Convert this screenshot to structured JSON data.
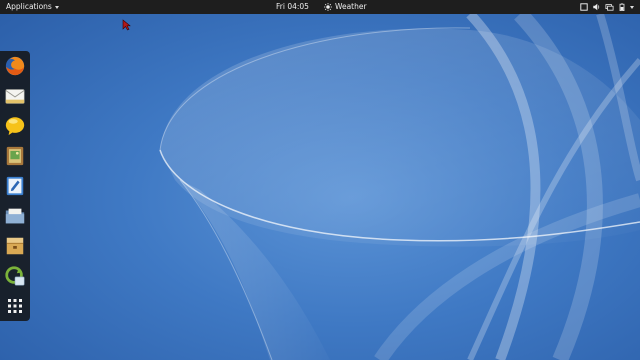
{
  "topbar": {
    "applications_label": "Applications",
    "clock": "Fri 04:05",
    "weather_label": "Weather"
  },
  "dock": {
    "items": [
      {
        "icon": "firefox-icon"
      },
      {
        "icon": "mail-icon"
      },
      {
        "icon": "chat-icon"
      },
      {
        "icon": "photos-icon"
      },
      {
        "icon": "text-editor-icon"
      },
      {
        "icon": "files-icon"
      },
      {
        "icon": "archive-icon"
      },
      {
        "icon": "software-update-icon"
      },
      {
        "icon": "app-grid-icon"
      }
    ]
  },
  "colors": {
    "topbar_bg": "#1e1e1e",
    "dock_bg": "#141414",
    "wallpaper_blue": "#3f79c4"
  }
}
